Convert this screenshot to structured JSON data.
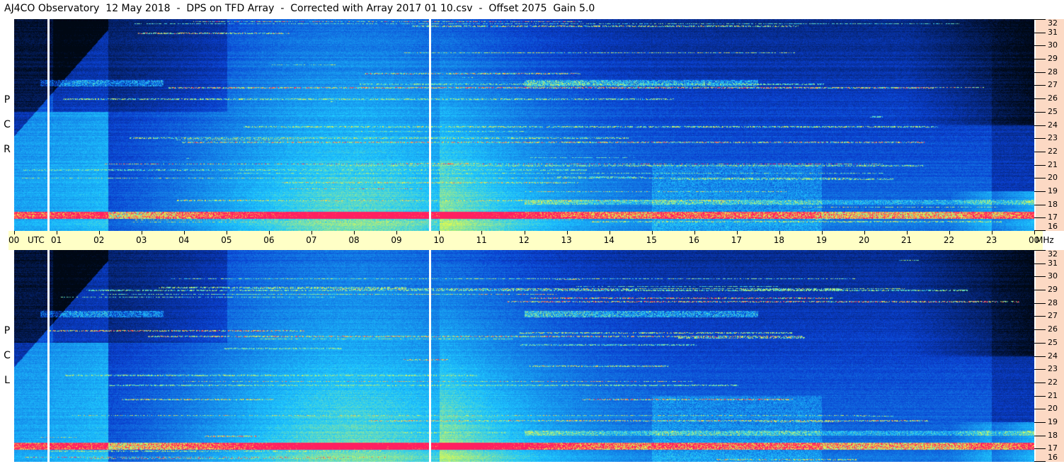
{
  "title": "AJ4CO Observatory  12 May 2018  -  DPS on TFD Array  -  Corrected with Array 2017 01 10.csv  -  Offset 2075  Gain 5.0",
  "panels": [
    {
      "id": "rcp",
      "letters": [
        "R",
        "C",
        "P"
      ]
    },
    {
      "id": "lcp",
      "letters": [
        "L",
        "C",
        "P"
      ]
    }
  ],
  "chart_data": {
    "type": "heatmap",
    "x_ticks": [
      "00",
      "01",
      "02",
      "03",
      "04",
      "05",
      "06",
      "07",
      "08",
      "09",
      "10",
      "11",
      "12",
      "13",
      "14",
      "15",
      "16",
      "17",
      "18",
      "19",
      "20",
      "21",
      "22",
      "23",
      "00"
    ],
    "x_unit_label": "UTC",
    "y_ticks": [
      "32",
      "31",
      "30",
      "29",
      "28",
      "27",
      "26",
      "25",
      "24",
      "23",
      "22",
      "21",
      "20",
      "19",
      "18",
      "17",
      "16"
    ],
    "y_unit_label": "MHz",
    "xlim": [
      0,
      24
    ],
    "ylim": [
      16,
      32
    ],
    "data_gaps_utc": [
      0.8,
      9.78
    ],
    "colors": {
      "low": "#000814",
      "mid_low": "#0a3fd0",
      "mid": "#1ec8ff",
      "high": "#f0ff40",
      "peak": "#ff2060",
      "time_bar": "#ffffc6",
      "freq_strip": "#fcd9c4"
    }
  }
}
